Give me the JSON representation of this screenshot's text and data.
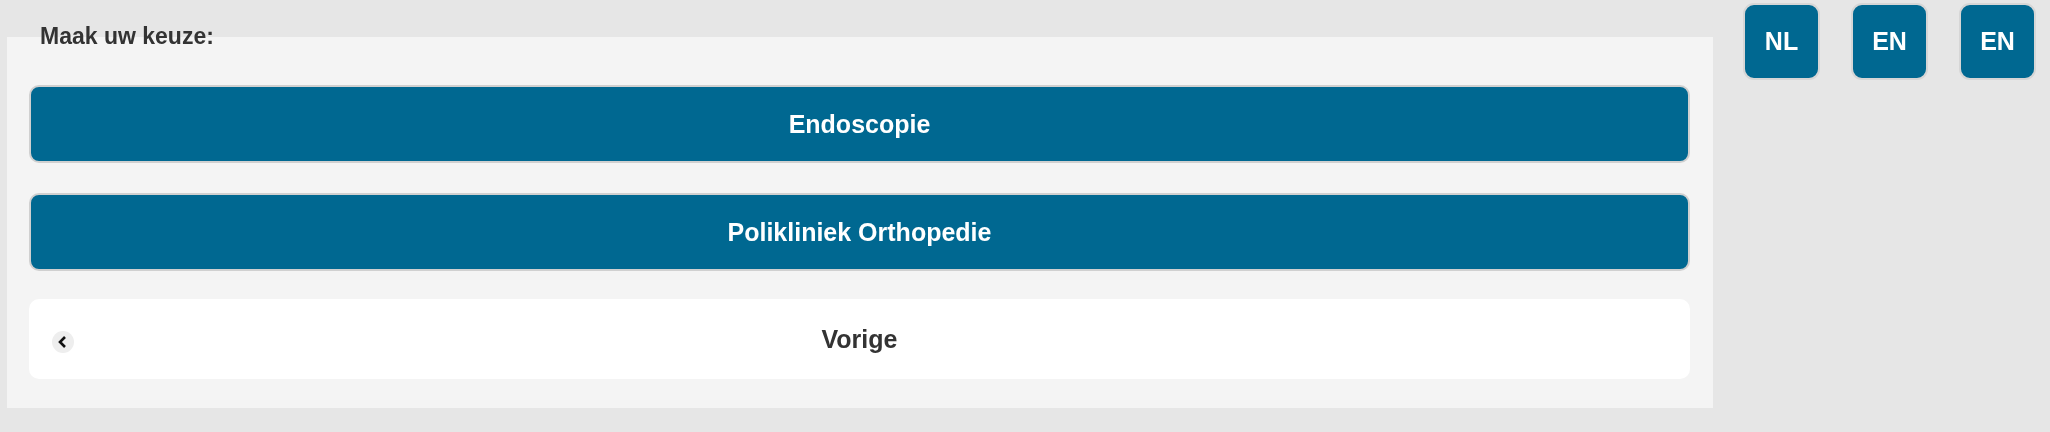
{
  "prompt": "Maak uw keuze:",
  "choices": [
    "Endoscopie",
    "Polikliniek Orthopedie"
  ],
  "back_button": {
    "label": "Vorige"
  },
  "languages": [
    "NL",
    "EN",
    "EN"
  ]
}
